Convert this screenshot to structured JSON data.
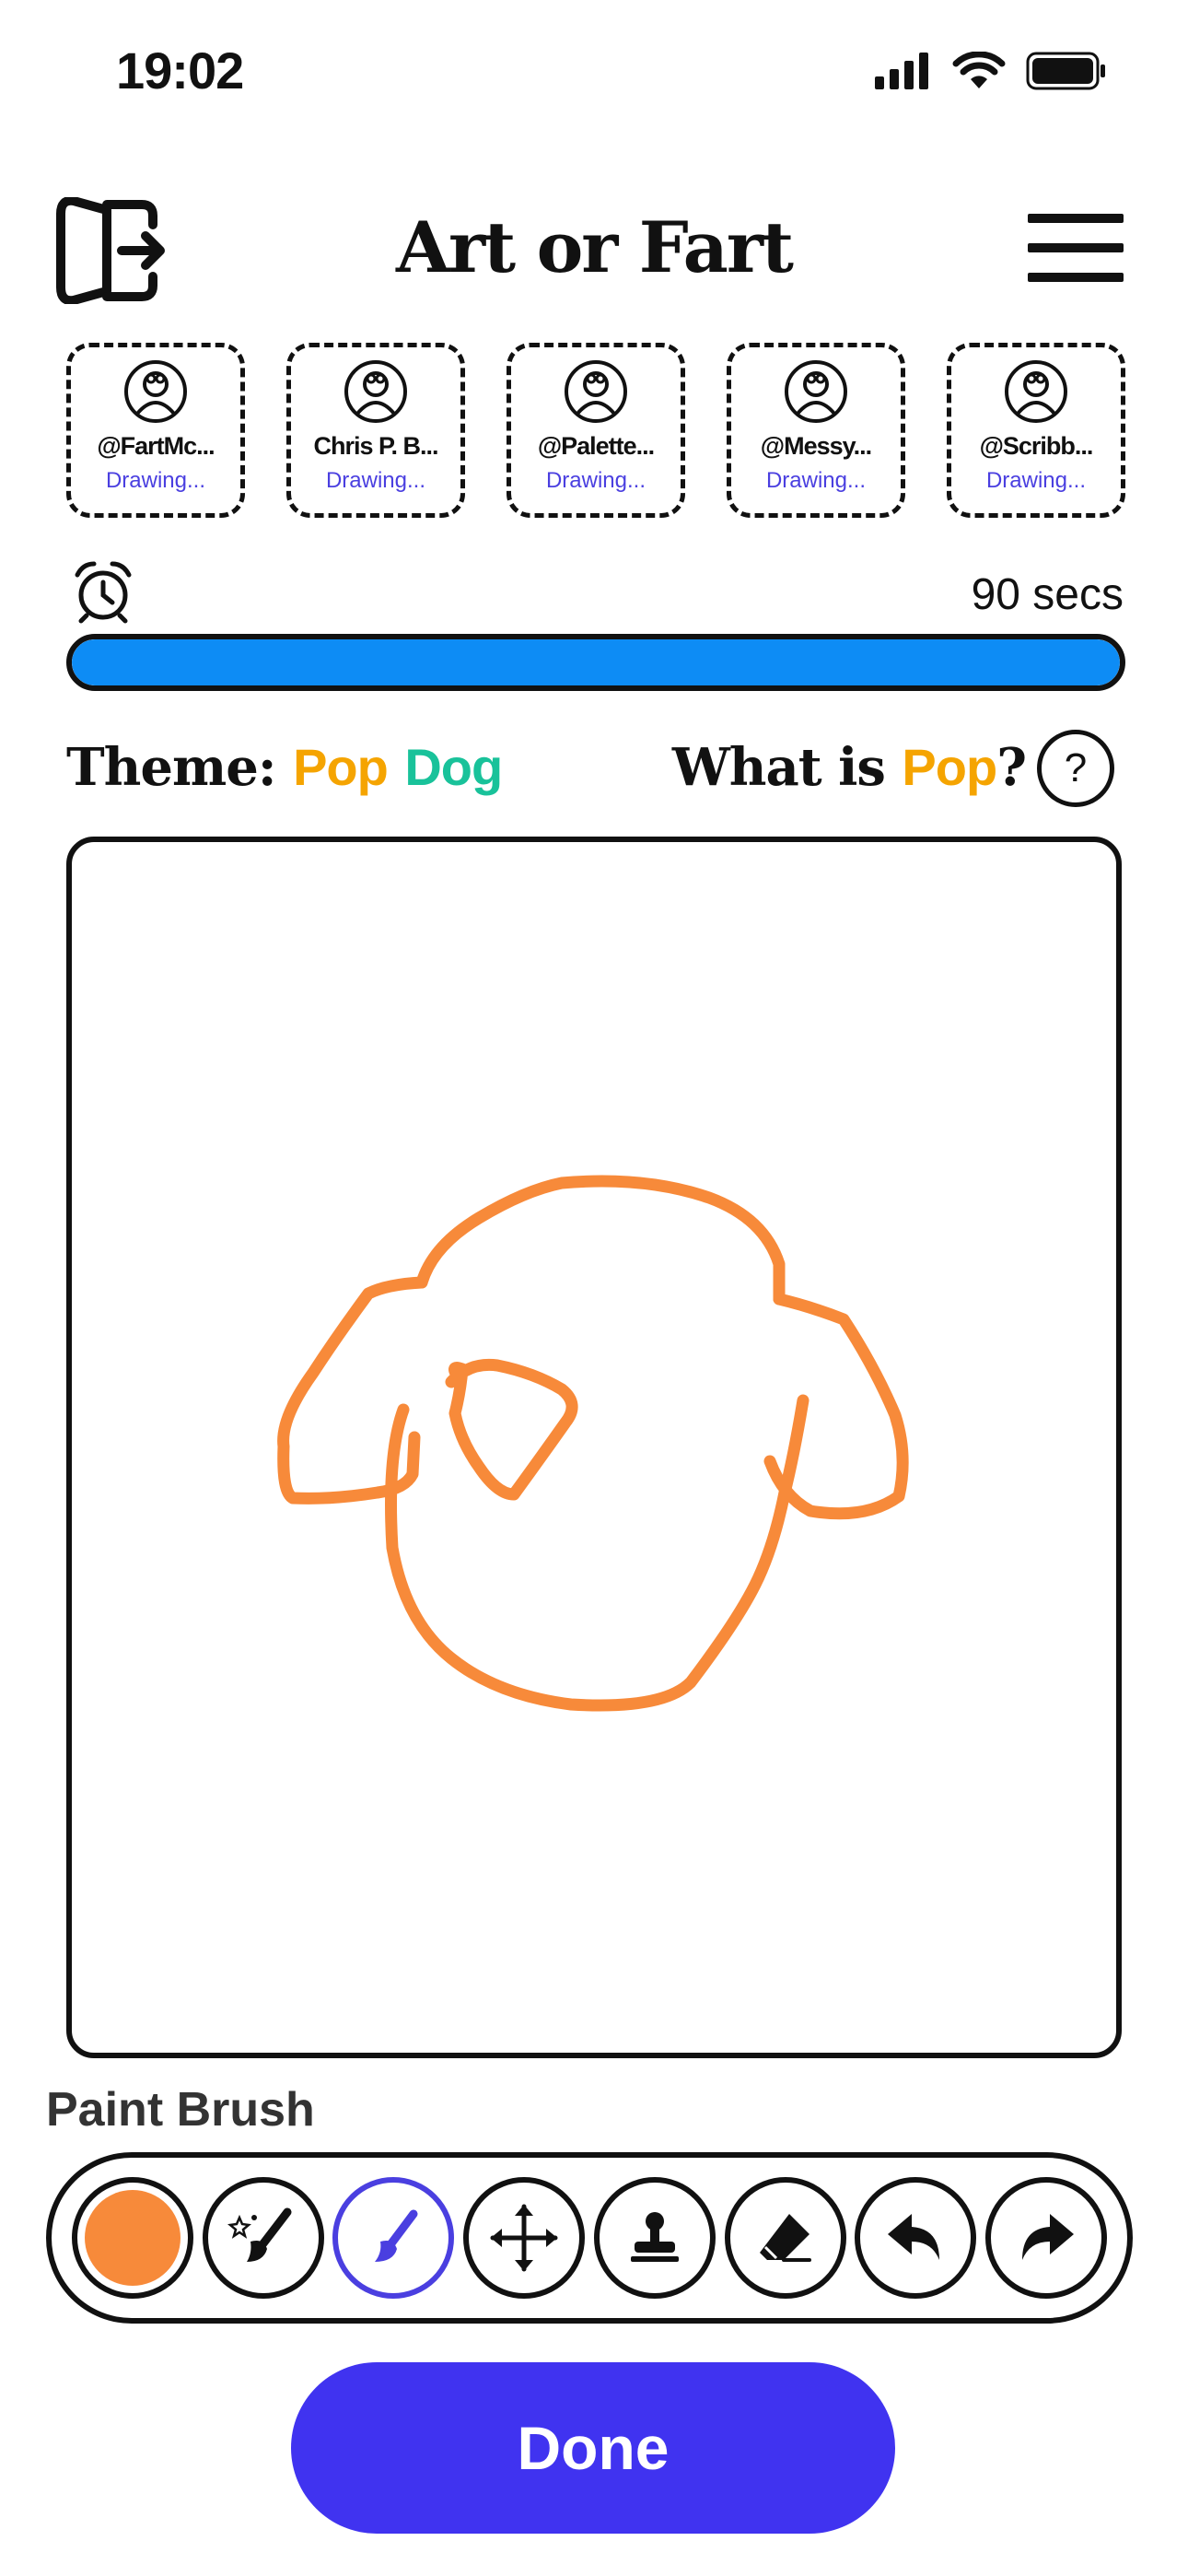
{
  "status_bar": {
    "time": "19:02"
  },
  "header": {
    "title": "Art or Fart"
  },
  "players": [
    {
      "name": "@FartMc...",
      "status": "Drawing..."
    },
    {
      "name": "Chris P. B...",
      "status": "Drawing..."
    },
    {
      "name": "@Palette...",
      "status": "Drawing..."
    },
    {
      "name": "@Messy...",
      "status": "Drawing..."
    },
    {
      "name": "@Scribb...",
      "status": "Drawing..."
    }
  ],
  "timer": {
    "text": "90 secs",
    "progress_fraction": 1.0,
    "color": "#0d8cf5"
  },
  "theme": {
    "label": "Theme:",
    "word1": "Pop",
    "word2": "Dog",
    "word1_color": "#f5a400",
    "word2_color": "#19c29a"
  },
  "whatis": {
    "prefix": "What is",
    "word": "Pop",
    "suffix": "?",
    "help_label": "?"
  },
  "tool": {
    "label": "Paint Brush",
    "current_color": "#f78a3a"
  },
  "toolbar": {
    "items": [
      {
        "icon": "color-swatch"
      },
      {
        "icon": "magic-brush-icon"
      },
      {
        "icon": "paint-brush-icon",
        "selected": true
      },
      {
        "icon": "move-arrows-icon"
      },
      {
        "icon": "stamp-icon"
      },
      {
        "icon": "eraser-icon"
      },
      {
        "icon": "undo-icon"
      },
      {
        "icon": "redo-icon"
      }
    ]
  },
  "done_label": "Done",
  "colors": {
    "accent": "#4033f0",
    "stroke": "#f78a3a"
  }
}
